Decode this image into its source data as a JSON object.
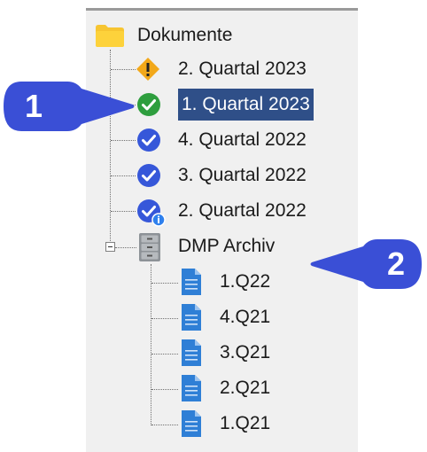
{
  "tree": {
    "root": {
      "label": "Dokumente",
      "icon": "folder-icon"
    },
    "reports": [
      {
        "label": "2. Quartal 2023",
        "icon": "warning-icon",
        "selected": false
      },
      {
        "label": "1. Quartal 2023",
        "icon": "check-green-icon",
        "selected": true
      },
      {
        "label": "4. Quartal 2022",
        "icon": "check-blue-icon",
        "selected": false
      },
      {
        "label": "3. Quartal 2022",
        "icon": "check-blue-icon",
        "selected": false
      },
      {
        "label": "2. Quartal 2022",
        "icon": "check-blue-info-icon",
        "selected": false
      }
    ],
    "archive": {
      "label": "DMP Archiv",
      "icon": "cabinet-icon",
      "files": [
        {
          "label": "1.Q22"
        },
        {
          "label": "4.Q21"
        },
        {
          "label": "3.Q21"
        },
        {
          "label": "2.Q21"
        },
        {
          "label": "1.Q21"
        }
      ]
    }
  },
  "callouts": [
    {
      "number": "1"
    },
    {
      "number": "2"
    }
  ],
  "colors": {
    "selection": "#2f4f88",
    "callout": "#3a4fd6",
    "check_green": "#2e9e3e",
    "check_blue": "#3657d9",
    "warning": "#f2a81a",
    "folder": "#f7c531",
    "file": "#2f7fd6"
  }
}
